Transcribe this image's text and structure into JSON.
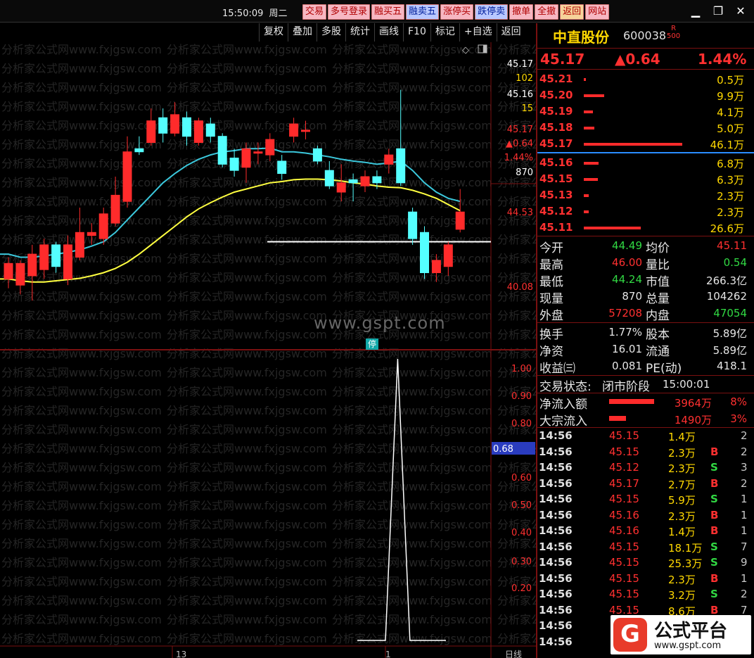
{
  "header": {
    "time": "15:50:09",
    "weekday": "周二",
    "buttons": [
      {
        "label": "交易",
        "style": "pink"
      },
      {
        "label": "多号登录",
        "style": "pink"
      },
      {
        "label": "融买五",
        "style": "pink"
      },
      {
        "label": "融卖五",
        "style": "blue"
      },
      {
        "label": "涨停买",
        "style": "pink"
      },
      {
        "label": "跌停卖",
        "style": "blue"
      },
      {
        "label": "撤单",
        "style": "pink"
      },
      {
        "label": "全撤",
        "style": "pink"
      },
      {
        "label": "返回",
        "style": "gold"
      },
      {
        "label": "网站",
        "style": "pink"
      }
    ],
    "window_icons": [
      "minimize-icon",
      "restore-icon",
      "close-icon"
    ]
  },
  "toolbar": {
    "items": [
      "复权",
      "叠加",
      "多股",
      "统计",
      "画线",
      "F10",
      "标记",
      "+自选",
      "返回"
    ],
    "corner_icons": [
      "diamond-icon",
      "panel-toggle-icon"
    ]
  },
  "chart": {
    "watermark_text": "分析家公式网www.fxjgsw.com",
    "center_watermark": "www.gspt.com",
    "stop_badge": "停",
    "price_axis": [
      "45.17",
      "102",
      "45.16",
      "15",
      "45.17",
      "▲0.64",
      "1.44%",
      "870",
      "44.53",
      "40.08"
    ],
    "price_axis_colors": [
      "#ffffff",
      "#ffd800",
      "#ffffff",
      "#ffd800",
      "#ff3030",
      "#ff3030",
      "#ff3030",
      "#ffffff",
      "#ff3030",
      "#ff3030"
    ],
    "indicator_axis": [
      "1.00",
      "0.90",
      "0.80",
      "0.68",
      "0.60",
      "0.50",
      "0.40",
      "0.30",
      "0.20"
    ],
    "bottom_labels": [
      "13",
      "1",
      "日线"
    ],
    "colors": {
      "up": "#ff2b2b",
      "down": "#54ffff",
      "ma_fast": "#3bc8dc",
      "ma_slow": "#ffff40",
      "grid": "#7a1010",
      "highlight": "#2a3cbf"
    }
  },
  "chart_data": {
    "type": "candlestick",
    "candles": [
      {
        "open": 43.45,
        "close": 43.7,
        "high": 43.8,
        "low": 43.3
      },
      {
        "open": 43.35,
        "close": 43.7,
        "high": 43.75,
        "low": 43.2
      },
      {
        "open": 43.5,
        "close": 43.85,
        "high": 44.0,
        "low": 43.1
      },
      {
        "open": 43.6,
        "close": 44.0,
        "high": 44.1,
        "low": 43.45
      },
      {
        "open": 44.0,
        "close": 43.65,
        "high": 44.05,
        "low": 43.55
      },
      {
        "open": 43.45,
        "close": 44.0,
        "high": 44.15,
        "low": 43.35
      },
      {
        "open": 43.8,
        "close": 44.2,
        "high": 44.6,
        "low": 43.75
      },
      {
        "open": 44.15,
        "close": 44.2,
        "high": 44.35,
        "low": 44.0
      },
      {
        "open": 44.1,
        "close": 44.5,
        "high": 44.6,
        "low": 44.0
      },
      {
        "open": 44.35,
        "close": 44.8,
        "high": 45.1,
        "low": 44.3
      },
      {
        "open": 44.7,
        "close": 45.5,
        "high": 45.75,
        "low": 44.6
      },
      {
        "open": 45.55,
        "close": 45.5,
        "high": 45.75,
        "low": 45.45
      },
      {
        "open": 45.65,
        "close": 46.0,
        "high": 46.2,
        "low": 45.6
      },
      {
        "open": 46.05,
        "close": 45.8,
        "high": 46.2,
        "low": 45.65
      },
      {
        "open": 45.8,
        "close": 46.1,
        "high": 46.3,
        "low": 45.75
      },
      {
        "open": 46.05,
        "close": 45.75,
        "high": 46.15,
        "low": 45.6
      },
      {
        "open": 45.65,
        "close": 46.0,
        "high": 46.05,
        "low": 45.6
      },
      {
        "open": 45.95,
        "close": 45.75,
        "high": 46.05,
        "low": 45.65
      },
      {
        "open": 45.75,
        "close": 45.3,
        "high": 45.8,
        "low": 45.25
      },
      {
        "open": 45.4,
        "close": 45.2,
        "high": 45.55,
        "low": 45.1
      },
      {
        "open": 45.25,
        "close": 45.55,
        "high": 45.65,
        "low": 45.0
      },
      {
        "open": 45.5,
        "close": 45.5,
        "high": 45.65,
        "low": 45.3
      },
      {
        "open": 45.45,
        "close": 45.7,
        "high": 45.8,
        "low": 45.35
      },
      {
        "open": 45.35,
        "close": 45.15,
        "high": 45.45,
        "low": 45.05
      },
      {
        "open": 45.75,
        "close": 45.95,
        "high": 46.05,
        "low": 45.65
      },
      {
        "open": 45.85,
        "close": 45.85,
        "high": 46.0,
        "low": 45.7
      },
      {
        "open": 45.55,
        "close": 45.35,
        "high": 45.6,
        "low": 45.3
      },
      {
        "open": 45.2,
        "close": 44.95,
        "high": 45.35,
        "low": 44.9
      },
      {
        "open": 44.85,
        "close": 45.0,
        "high": 45.3,
        "low": 44.7
      },
      {
        "open": 45.05,
        "close": 45.0,
        "high": 45.15,
        "low": 44.7
      },
      {
        "open": 44.95,
        "close": 45.1,
        "high": 45.2,
        "low": 44.85
      },
      {
        "open": 45.1,
        "close": 45.0,
        "high": 45.2,
        "low": 44.9
      },
      {
        "open": 45.3,
        "close": 45.45,
        "high": 45.55,
        "low": 45.15
      },
      {
        "open": 45.55,
        "close": 45.0,
        "high": 46.5,
        "low": 44.95
      },
      {
        "open": 44.53,
        "close": 44.1,
        "high": 44.6,
        "low": 44.0
      },
      {
        "open": 44.2,
        "close": 43.55,
        "high": 44.3,
        "low": 43.45
      },
      {
        "open": 43.55,
        "close": 43.75,
        "high": 43.85,
        "low": 43.4
      },
      {
        "open": 43.65,
        "close": 44.0,
        "high": 44.05,
        "low": 43.5
      },
      {
        "open": 44.25,
        "close": 44.53,
        "high": 44.9,
        "low": 44.2
      }
    ],
    "ma_fast": [
      43.85,
      43.8,
      43.8,
      43.82,
      43.85,
      43.88,
      43.92,
      43.98,
      44.05,
      44.2,
      44.4,
      44.6,
      44.8,
      45.0,
      45.15,
      45.28,
      45.38,
      45.45,
      45.5,
      45.52,
      45.55,
      45.55,
      45.56,
      45.5,
      45.5,
      45.48,
      45.45,
      45.42,
      45.38,
      45.35,
      45.33,
      45.3,
      45.32,
      45.35,
      45.2,
      45.0,
      44.85,
      44.75,
      44.7
    ],
    "ma_slow": [
      43.45,
      43.42,
      43.4,
      43.4,
      43.42,
      43.44,
      43.46,
      43.5,
      43.55,
      43.62,
      43.72,
      43.85,
      44.0,
      44.15,
      44.3,
      44.45,
      44.58,
      44.68,
      44.77,
      44.85,
      44.9,
      44.95,
      45.0,
      45.02,
      45.05,
      45.06,
      45.06,
      45.05,
      45.03,
      45.0,
      44.98,
      44.95,
      44.93,
      44.92,
      44.88,
      44.82,
      44.75,
      44.65,
      44.55
    ],
    "support_line": 44.05,
    "indicator": {
      "x": [
        0,
        20,
        23,
        26,
        30
      ],
      "values": [
        0,
        0,
        1.0,
        0,
        0
      ],
      "ylim": [
        0,
        1.0
      ]
    }
  },
  "panel": {
    "name": "中直股份",
    "code": "600038",
    "r_badge_top": "R",
    "r_badge_bottom": "500",
    "last": "45.17",
    "change": "▲0.64",
    "change_pct": "1.44%",
    "asks": [
      {
        "price": "45.21",
        "vol": "0.5万",
        "bar": 0.02
      },
      {
        "price": "45.20",
        "vol": "9.9万",
        "bar": 0.21
      },
      {
        "price": "45.19",
        "vol": "4.1万",
        "bar": 0.09
      },
      {
        "price": "45.18",
        "vol": "5.0万",
        "bar": 0.11
      },
      {
        "price": "45.17",
        "vol": "46.1万",
        "bar": 1.0
      }
    ],
    "bids": [
      {
        "price": "45.16",
        "vol": "6.8万",
        "bar": 0.15
      },
      {
        "price": "45.15",
        "vol": "6.3万",
        "bar": 0.14
      },
      {
        "price": "45.13",
        "vol": "2.3万",
        "bar": 0.05
      },
      {
        "price": "45.12",
        "vol": "2.3万",
        "bar": 0.05
      },
      {
        "price": "45.11",
        "vol": "26.6万",
        "bar": 0.58
      }
    ],
    "stats": [
      {
        "l1": "今开",
        "v1": "44.49",
        "c1": "#31d943",
        "l2": "均价",
        "v2": "45.11",
        "c2": "#ff3030"
      },
      {
        "l1": "最高",
        "v1": "46.00",
        "c1": "#ff3030",
        "l2": "量比",
        "v2": "0.54",
        "c2": "#31d943"
      },
      {
        "l1": "最低",
        "v1": "44.24",
        "c1": "#31d943",
        "l2": "市值",
        "v2": "266.3亿",
        "c2": "#e6e6e6"
      },
      {
        "l1": "现量",
        "v1": "870",
        "c1": "#e6e6e6",
        "l2": "总量",
        "v2": "104262",
        "c2": "#e6e6e6"
      },
      {
        "l1": "外盘",
        "v1": "57208",
        "c1": "#ff3030",
        "l2": "内盘",
        "v2": "47054",
        "c2": "#31d943"
      }
    ],
    "stats2": [
      {
        "l1": "换手",
        "v1": "1.77%",
        "c1": "#e6e6e6",
        "l2": "股本",
        "v2": "5.89亿",
        "c2": "#e6e6e6"
      },
      {
        "l1": "净资",
        "v1": "16.01",
        "c1": "#e6e6e6",
        "l2": "流通",
        "v2": "5.89亿",
        "c2": "#e6e6e6"
      },
      {
        "l1": "收益㈢",
        "v1": "0.081",
        "c1": "#e6e6e6",
        "l2": "PE(动)",
        "v2": "418.1",
        "c2": "#e6e6e6"
      }
    ],
    "trade_state_label": "交易状态:",
    "trade_state_value": "闭市阶段",
    "trade_state_time": "15:00:01",
    "flows": [
      {
        "label": "净流入额",
        "value": "3964万",
        "pct": "8%",
        "bar": 0.85
      },
      {
        "label": "大宗流入",
        "value": "1490万",
        "pct": "3%",
        "bar": 0.32
      }
    ],
    "trades": [
      {
        "time": "14:56",
        "price": "45.15",
        "vol": "1.4万",
        "side": "",
        "num": "2"
      },
      {
        "time": "14:56",
        "price": "45.15",
        "vol": "2.3万",
        "side": "B",
        "num": "2"
      },
      {
        "time": "14:56",
        "price": "45.12",
        "vol": "2.3万",
        "side": "S",
        "num": "3"
      },
      {
        "time": "14:56",
        "price": "45.17",
        "vol": "2.7万",
        "side": "B",
        "num": "2"
      },
      {
        "time": "14:56",
        "price": "45.15",
        "vol": "5.9万",
        "side": "S",
        "num": "1"
      },
      {
        "time": "14:56",
        "price": "45.16",
        "vol": "2.3万",
        "side": "B",
        "num": "1"
      },
      {
        "time": "14:56",
        "price": "45.16",
        "vol": "1.4万",
        "side": "B",
        "num": "1"
      },
      {
        "time": "14:56",
        "price": "45.15",
        "vol": "18.1万",
        "side": "S",
        "num": "7"
      },
      {
        "time": "14:56",
        "price": "45.15",
        "vol": "25.3万",
        "side": "S",
        "num": "9"
      },
      {
        "time": "14:56",
        "price": "45.15",
        "vol": "2.3万",
        "side": "B",
        "num": "1"
      },
      {
        "time": "14:56",
        "price": "45.15",
        "vol": "3.2万",
        "side": "S",
        "num": "2"
      },
      {
        "time": "14:56",
        "price": "45.15",
        "vol": "8.6万",
        "side": "B",
        "num": "7"
      },
      {
        "time": "14:56",
        "price": "",
        "vol": "",
        "side": "",
        "num": ""
      },
      {
        "time": "14:56",
        "price": "",
        "vol": "",
        "side": "",
        "num": ""
      }
    ]
  },
  "logo": {
    "mark": "G",
    "title": "公式平台",
    "url": "www.gspt.com"
  }
}
